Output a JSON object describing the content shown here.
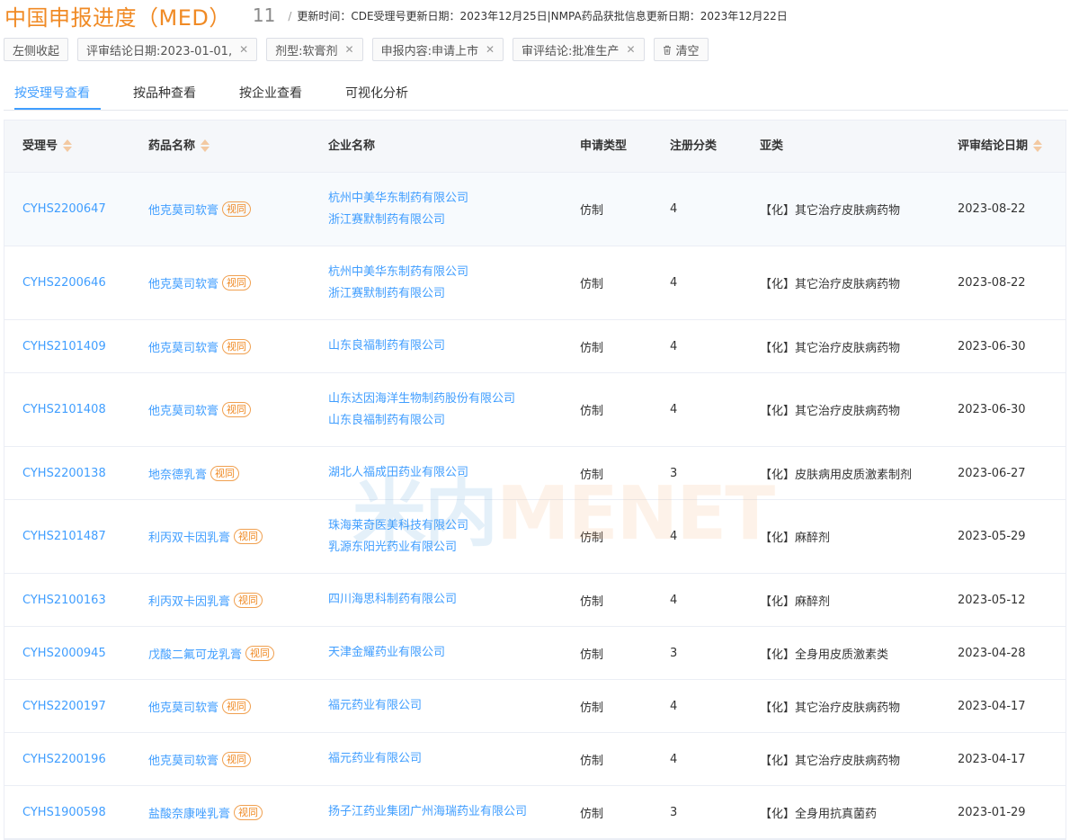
{
  "header": {
    "title": "中国申报进度（MED）",
    "count": "11",
    "update_text": "更新时间：CDE受理号更新日期：2023年12月25日|NMPA药品获批信息更新日期：2023年12月22日"
  },
  "filters": {
    "collapse_label": "左侧收起",
    "chips": [
      {
        "label": "评审结论日期:2023-01-01,"
      },
      {
        "label": "剂型:软膏剂"
      },
      {
        "label": "申报内容:申请上市"
      },
      {
        "label": "审评结论:批准生产"
      }
    ],
    "clear_label": "清空"
  },
  "tabs": [
    "按受理号查看",
    "按品种查看",
    "按企业查看",
    "可视化分析"
  ],
  "table": {
    "columns": [
      "受理号",
      "药品名称",
      "企业名称",
      "申请类型",
      "注册分类",
      "亚类",
      "评审结论日期"
    ],
    "tag_label": "视同",
    "rows": [
      {
        "id": "CYHS2200647",
        "drug": "他克莫司软膏",
        "companies": [
          "杭州中美华东制药有限公司",
          "浙江赛默制药有限公司"
        ],
        "type": "仿制",
        "cls": "4",
        "sub": "【化】其它治疗皮肤病药物",
        "date": "2023-08-22"
      },
      {
        "id": "CYHS2200646",
        "drug": "他克莫司软膏",
        "companies": [
          "杭州中美华东制药有限公司",
          "浙江赛默制药有限公司"
        ],
        "type": "仿制",
        "cls": "4",
        "sub": "【化】其它治疗皮肤病药物",
        "date": "2023-08-22"
      },
      {
        "id": "CYHS2101409",
        "drug": "他克莫司软膏",
        "companies": [
          "山东良福制药有限公司"
        ],
        "type": "仿制",
        "cls": "4",
        "sub": "【化】其它治疗皮肤病药物",
        "date": "2023-06-30"
      },
      {
        "id": "CYHS2101408",
        "drug": "他克莫司软膏",
        "companies": [
          "山东达因海洋生物制药股份有限公司",
          "山东良福制药有限公司"
        ],
        "type": "仿制",
        "cls": "4",
        "sub": "【化】其它治疗皮肤病药物",
        "date": "2023-06-30"
      },
      {
        "id": "CYHS2200138",
        "drug": "地奈德乳膏",
        "companies": [
          "湖北人福成田药业有限公司"
        ],
        "type": "仿制",
        "cls": "3",
        "sub": "【化】皮肤病用皮质激素制剂",
        "date": "2023-06-27"
      },
      {
        "id": "CYHS2101487",
        "drug": "利丙双卡因乳膏",
        "companies": [
          "珠海莱奇医美科技有限公司",
          "乳源东阳光药业有限公司"
        ],
        "type": "仿制",
        "cls": "4",
        "sub": "【化】麻醉剂",
        "date": "2023-05-29"
      },
      {
        "id": "CYHS2100163",
        "drug": "利丙双卡因乳膏",
        "companies": [
          "四川海思科制药有限公司"
        ],
        "type": "仿制",
        "cls": "4",
        "sub": "【化】麻醉剂",
        "date": "2023-05-12"
      },
      {
        "id": "CYHS2000945",
        "drug": "戊酸二氟可龙乳膏",
        "companies": [
          "天津金耀药业有限公司"
        ],
        "type": "仿制",
        "cls": "3",
        "sub": "【化】全身用皮质激素类",
        "date": "2023-04-28"
      },
      {
        "id": "CYHS2200197",
        "drug": "他克莫司软膏",
        "companies": [
          "福元药业有限公司"
        ],
        "type": "仿制",
        "cls": "4",
        "sub": "【化】其它治疗皮肤病药物",
        "date": "2023-04-17"
      },
      {
        "id": "CYHS2200196",
        "drug": "他克莫司软膏",
        "companies": [
          "福元药业有限公司"
        ],
        "type": "仿制",
        "cls": "4",
        "sub": "【化】其它治疗皮肤病药物",
        "date": "2023-04-17"
      },
      {
        "id": "CYHS1900598",
        "drug": "盐酸奈康唑乳膏",
        "companies": [
          "扬子江药业集团广州海瑞药业有限公司"
        ],
        "type": "仿制",
        "cls": "3",
        "sub": "【化】全身用抗真菌药",
        "date": "2023-01-29"
      }
    ]
  },
  "watermark": {
    "cn": "米内",
    "en": "MENET"
  },
  "colors": {
    "accent": "#f08a24",
    "link": "#409eff",
    "tag": "#f08a24"
  }
}
